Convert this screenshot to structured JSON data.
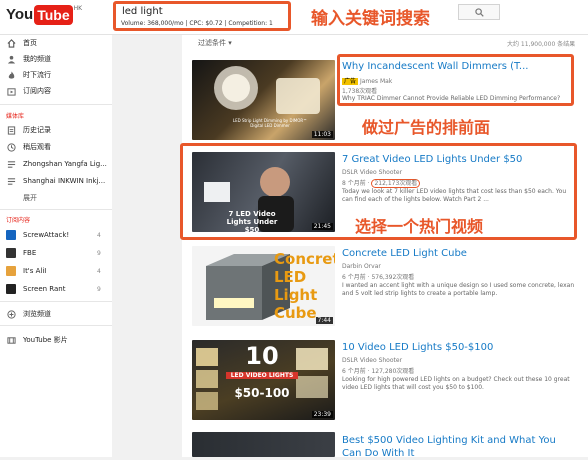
{
  "header": {
    "logo_you": "You",
    "logo_tube": "Tube",
    "logo_region": "HK",
    "search_query": "led light",
    "search_meta": "Volume: 368,000/mo | CPC: $0.72 | Competition: 1",
    "search_button_icon": "search-icon"
  },
  "annotations": {
    "search": "输入关键词搜索",
    "ad": "做过广告的排前面",
    "hot": "选择一个热门视频"
  },
  "sidebar": {
    "items": [
      {
        "label": "首页",
        "icon": "home-icon"
      },
      {
        "label": "我的频道",
        "icon": "person-icon"
      },
      {
        "label": "时下流行",
        "icon": "fire-icon"
      },
      {
        "label": "订阅内容",
        "icon": "subscriptions-icon"
      }
    ],
    "library_title": "媒体库",
    "library": [
      {
        "label": "历史记录",
        "icon": "history-icon"
      },
      {
        "label": "稍后观看",
        "icon": "clock-icon"
      },
      {
        "label": "Zhongshan Yangfa Lig...",
        "icon": "playlist-icon"
      },
      {
        "label": "Shanghai INKWIN Inkj...",
        "icon": "playlist-icon"
      },
      {
        "label": "展开",
        "icon": ""
      }
    ],
    "subs_title": "订阅内容",
    "subscriptions": [
      {
        "label": "ScrewAttack!",
        "count": "4",
        "color": "#1565c0"
      },
      {
        "label": "FBE",
        "count": "9",
        "color": "#333333"
      },
      {
        "label": "It's AliI",
        "count": "4",
        "color": "#e6a23c"
      },
      {
        "label": "Screen Rant",
        "count": "9",
        "color": "#222222"
      }
    ],
    "browse": {
      "label": "浏览频道",
      "icon": "plus-circle-icon"
    },
    "movies": {
      "label": "YouTube 影片",
      "icon": "film-icon"
    }
  },
  "results": {
    "filter_label": "过滤条件",
    "count_text": "大约 11,900,000 条结果",
    "videos": [
      {
        "title": "Why Incandescent Wall Dimmers (T...",
        "ad_badge": "广告",
        "channel": "James Mak",
        "views": "1,738次观看",
        "desc": "Why TRIAC Dimmer Cannot Provide Reliable LED Dimming Performance?",
        "duration": "11:03",
        "thumb_caption": "LED Strip Light Dimming by DIMOR™ Digital LED Dimmer"
      },
      {
        "title": "7 Great Video LED Lights Under $50",
        "channel": "DSLR Video Shooter",
        "age": "8 个月前",
        "views": "212,173次观看",
        "desc": "Today we look at 7 killer LED video lights that cost less than $50 each. You can find each of the lights below. Watch Part 2 ...",
        "duration": "21:45",
        "thumb_caption": "7 LED Video Lights Under $50"
      },
      {
        "title": "Concrete LED Light Cube",
        "channel": "Darbin Orvar",
        "age": "6 个月前",
        "views": "576,392次观看",
        "desc": "I wanted an accent light with a unique design so I used some concrete, lexan and 5 volt led strip lights to create a portable lamp.",
        "duration": "7:44",
        "thumb_caption": "Concrete LED Light Cube"
      },
      {
        "title": "10 Video LED Lights $50-$100",
        "channel": "DSLR Video Shooter",
        "age": "6 个月前",
        "views": "127,280次观看",
        "desc": "Looking for high powered LED lights on a budget? Check out these 10 great video LED lights that will cost you $50 to $100.",
        "duration": "23:39",
        "thumb_caption_big": "10",
        "thumb_caption": "LED VIDEO LIGHTS",
        "thumb_price": "$50-100"
      },
      {
        "title": "Best $500 Video Lighting Kit and What You Can Do With It"
      }
    ]
  },
  "colors": {
    "youtube_red": "#e62117",
    "link_blue": "#167ac6",
    "annotation_orange": "#e8572a"
  }
}
